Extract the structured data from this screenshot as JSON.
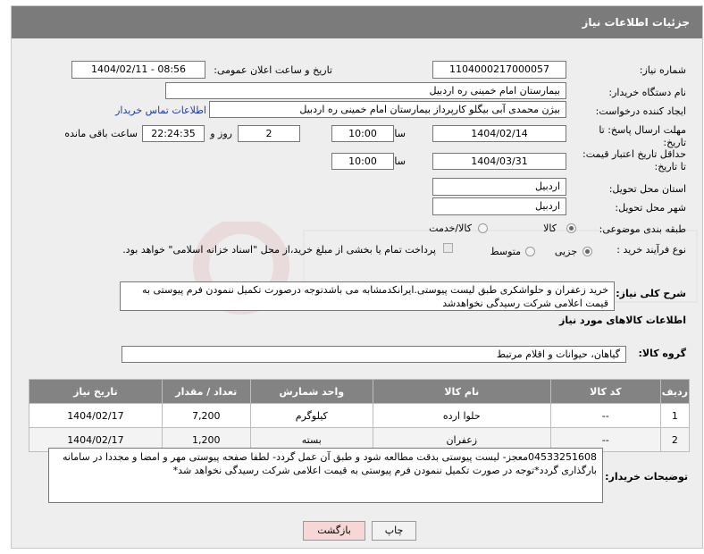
{
  "panel_title": "جزئیات اطلاعات نیاز",
  "fields": {
    "need_number": {
      "label": "شماره نیاز:",
      "value": "1104000217000057"
    },
    "announce_datetime": {
      "label": "تاریخ و ساعت اعلان عمومی:",
      "value": "1404/02/11 - 08:56"
    },
    "buyer_org": {
      "label": "نام دستگاه خریدار:",
      "value": "بیمارستان امام خمینی  ره  اردبیل"
    },
    "requester": {
      "label": "ایجاد کننده درخواست:",
      "value": "بیژن محمدی آبی بیگلو کارپرداز بیمارستان امام خمینی  ره  اردبیل",
      "contact_link": "اطلاعات تماس خریدار"
    },
    "reply_deadline": {
      "label": "مهلت ارسال پاسخ: تا تاریخ:",
      "date": "1404/02/14",
      "time_label": "ساعت",
      "time": "10:00",
      "days": "2",
      "days_label": "روز و",
      "remaining": "22:24:35",
      "remaining_label": "ساعت باقی مانده"
    },
    "price_validity": {
      "label": "حداقل تاریخ اعتبار قیمت: تا تاریخ:",
      "date": "1404/03/31",
      "time_label": "ساعت",
      "time": "10:00"
    },
    "delivery_province": {
      "label": "استان محل تحویل:",
      "value": "اردبیل"
    },
    "delivery_city": {
      "label": "شهر محل تحویل:",
      "value": "اردبیل"
    },
    "category": {
      "label": "طبقه بندی موضوعی:",
      "options": [
        "کالا",
        "کالا/خدمت"
      ],
      "selected": "کالا"
    },
    "purchase_process": {
      "label": "نوع فرآیند خرید :",
      "options": [
        "جزیی",
        "متوسط"
      ],
      "selected": "جزیی",
      "payment_note": "پرداخت تمام یا بخشی از مبلغ خرید،از محل \"اسناد خزانه اسلامی\" خواهد بود."
    }
  },
  "description": {
    "label": "شرح کلی نیاز:",
    "value": "خرید زعفران و حلواشکری طبق لیست پیوستی.ایرانکدمشابه می باشدتوجه درصورت تکمیل ننمودن فرم پیوستی به قیمت اعلامی شرکت رسیدگی نخواهدشد"
  },
  "goods_section_title": "اطلاعات کالاهای مورد نیاز",
  "goods_group": {
    "label": "گروه کالا:",
    "value": "گیاهان، حیوانات و اقلام مرتبط"
  },
  "table": {
    "headers": [
      "ردیف",
      "کد کالا",
      "نام کالا",
      "واحد شمارش",
      "تعداد / مقدار",
      "تاریخ نیاز"
    ],
    "rows": [
      {
        "row": "1",
        "code": "--",
        "name": "حلوا ارده",
        "unit": "کیلوگرم",
        "qty": "7,200",
        "date": "1404/02/17"
      },
      {
        "row": "2",
        "code": "--",
        "name": "زعفران",
        "unit": "بسته",
        "qty": "1,200",
        "date": "1404/02/17"
      }
    ]
  },
  "buyer_notes": {
    "label": "توضیحات خریدار:",
    "value": "04533251608معجز- لیست پیوستی بدقت مطالعه شود و طبق آن عمل گردد- لطفا صفحه پیوستی مهر و امضا و مجددا در سامانه بارگذاری گردد*توجه در صورت تکمیل ننمودن فرم پیوستی به قیمت اعلامی شرکت رسیدگی نخواهد شد*"
  },
  "buttons": {
    "print": "چاپ",
    "back": "بازگشت"
  },
  "colors": {
    "header_bg": "#7b7b7b",
    "panel_bg": "#eeeeee",
    "link": "#1a3d99",
    "back_btn": "#f7d6d6"
  }
}
